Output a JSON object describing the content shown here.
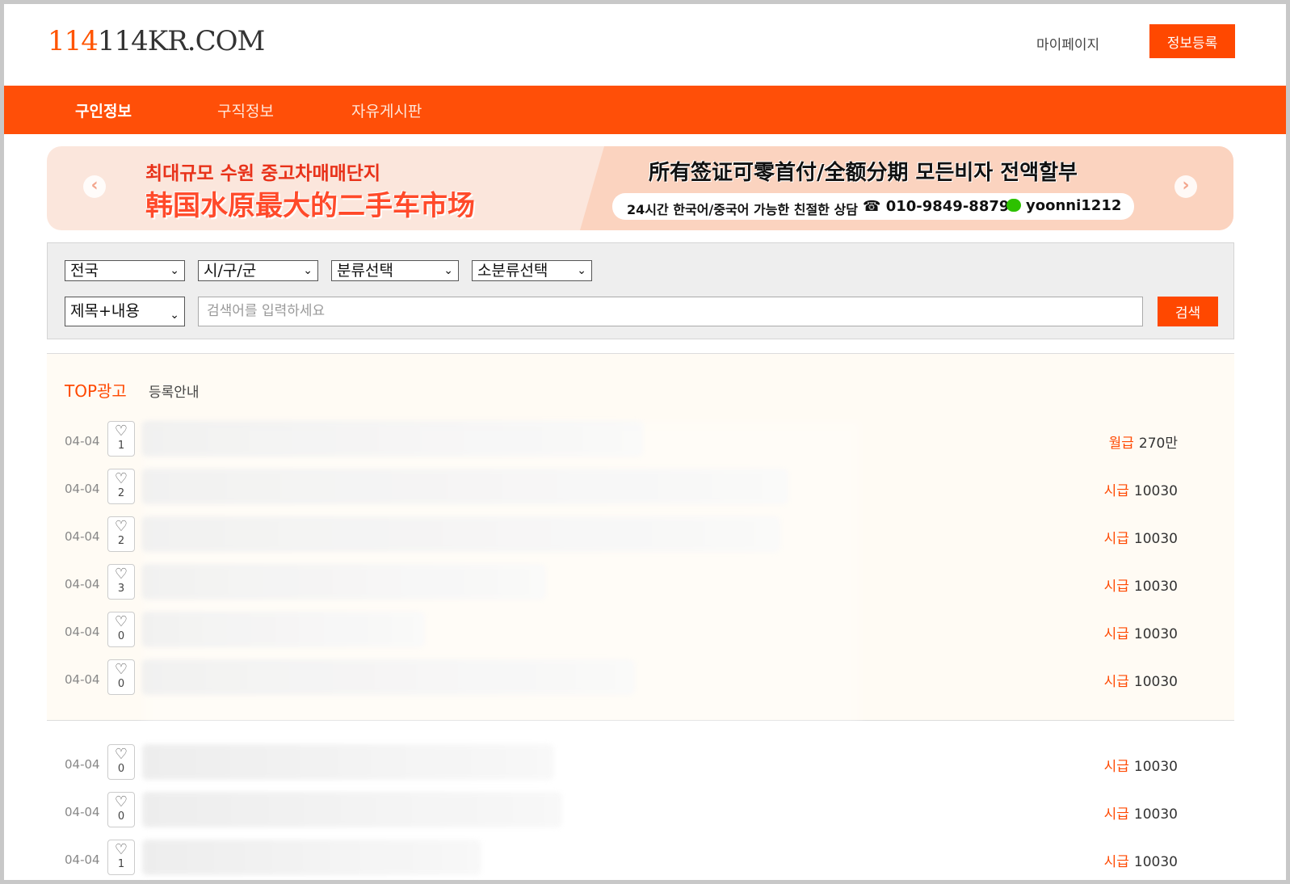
{
  "header": {
    "logo_accent": "114",
    "logo_rest": "114KR.COM",
    "mypage": "마이페이지",
    "register_button": "정보등록"
  },
  "nav": {
    "items": [
      {
        "label": "구인정보",
        "active": true
      },
      {
        "label": "구직정보",
        "active": false
      },
      {
        "label": "자유게시판",
        "active": false
      }
    ]
  },
  "banner": {
    "ko_title": "최대규모 수원 중고차매매단지",
    "cn_title": "韩国水原最大的二手车市场",
    "headline": "所有签证可零首付/全额分期  모든비자 전액할부",
    "consult": "24시간 한국어/중국어 가능한 친절한 상담",
    "phone": "☎ 010-9849-8879",
    "wechat": "yoonni1212",
    "prev_arrow": "‹",
    "next_arrow": "›"
  },
  "search": {
    "region": "전국",
    "district": "시/구/군",
    "category": "분류선택",
    "subcategory": "소분류선택",
    "scope": "제목+내용",
    "placeholder": "검색어를 입력하세요",
    "button": "검색",
    "chevron": "⌄"
  },
  "top_section": {
    "title": "TOP광고",
    "info": "등록안내"
  },
  "icons": {
    "heart": "♡"
  },
  "listings": [
    {
      "date": "04-04",
      "likes": "1",
      "wage_type": "월급",
      "wage": "270만"
    },
    {
      "date": "04-04",
      "likes": "2",
      "wage_type": "시급",
      "wage": "10030"
    },
    {
      "date": "04-04",
      "likes": "2",
      "wage_type": "시급",
      "wage": "10030"
    },
    {
      "date": "04-04",
      "likes": "3",
      "wage_type": "시급",
      "wage": "10030"
    },
    {
      "date": "04-04",
      "likes": "0",
      "wage_type": "시급",
      "wage": "10030"
    },
    {
      "date": "04-04",
      "likes": "0",
      "wage_type": "시급",
      "wage": "10030"
    },
    {
      "date": "04-04",
      "likes": "0",
      "wage_type": "시급",
      "wage": "10030"
    },
    {
      "date": "04-04",
      "likes": "0",
      "wage_type": "시급",
      "wage": "10030"
    },
    {
      "date": "04-04",
      "likes": "1",
      "wage_type": "시급",
      "wage": "10030"
    }
  ],
  "colors": {
    "brand": "#ff4f08",
    "accent": "#ff4800"
  }
}
